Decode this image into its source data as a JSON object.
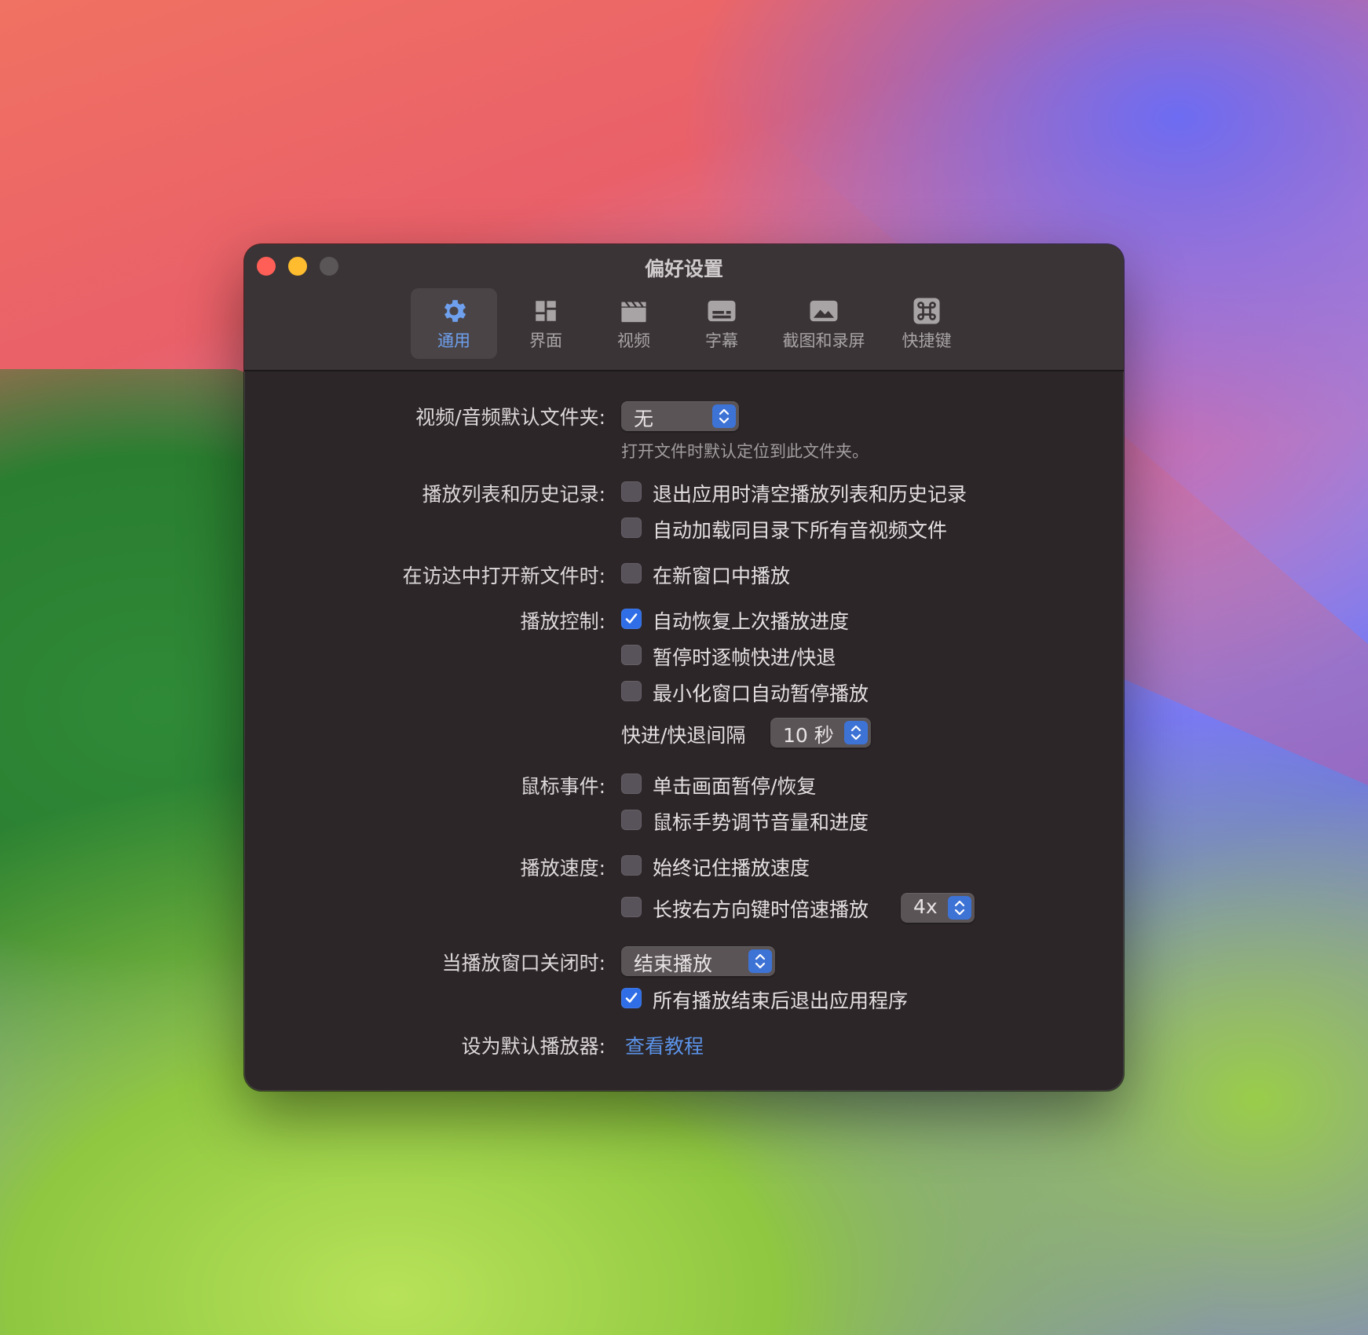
{
  "window": {
    "title": "偏好设置"
  },
  "tabs": [
    {
      "label": "通用",
      "icon": "gear-icon",
      "active": true
    },
    {
      "label": "界面",
      "icon": "layout-icon"
    },
    {
      "label": "视频",
      "icon": "clapperboard-icon"
    },
    {
      "label": "字幕",
      "icon": "subtitles-icon"
    },
    {
      "label": "截图和录屏",
      "icon": "photo-icon"
    },
    {
      "label": "快捷键",
      "icon": "command-icon"
    }
  ],
  "settings": {
    "default_folder": {
      "label": "视频/音频默认文件夹:",
      "value": "无",
      "hint": "打开文件时默认定位到此文件夹。"
    },
    "playlist": {
      "label": "播放列表和历史记录:",
      "options": [
        {
          "text": "退出应用时清空播放列表和历史记录",
          "checked": false
        },
        {
          "text": "自动加载同目录下所有音视频文件",
          "checked": false
        }
      ]
    },
    "finder_open": {
      "label": "在访达中打开新文件时:",
      "options": [
        {
          "text": "在新窗口中播放",
          "checked": false
        }
      ]
    },
    "playback_control": {
      "label": "播放控制:",
      "options": [
        {
          "text": "自动恢复上次播放进度",
          "checked": true
        },
        {
          "text": "暂停时逐帧快进/快退",
          "checked": false
        },
        {
          "text": "最小化窗口自动暂停播放",
          "checked": false
        }
      ],
      "seek_label": "快进/快退间隔",
      "seek_value": "10 秒"
    },
    "mouse_events": {
      "label": "鼠标事件:",
      "options": [
        {
          "text": "单击画面暂停/恢复",
          "checked": false
        },
        {
          "text": "鼠标手势调节音量和进度",
          "checked": false
        }
      ]
    },
    "playback_speed": {
      "label": "播放速度:",
      "options": [
        {
          "text": "始终记住播放速度",
          "checked": false
        },
        {
          "text": "长按右方向键时倍速播放",
          "checked": false
        }
      ],
      "speed_value": "4x"
    },
    "window_close": {
      "label": "当播放窗口关闭时:",
      "value": "结束播放",
      "options": [
        {
          "text": "所有播放结束后退出应用程序",
          "checked": true
        }
      ]
    },
    "default_player": {
      "label": "设为默认播放器:",
      "link": "查看教程"
    }
  },
  "colors": {
    "accent": "#2f6ee6",
    "active_tab_text": "#6ea0ee",
    "link": "#5b93e8",
    "window_bg": "#2c2628"
  }
}
